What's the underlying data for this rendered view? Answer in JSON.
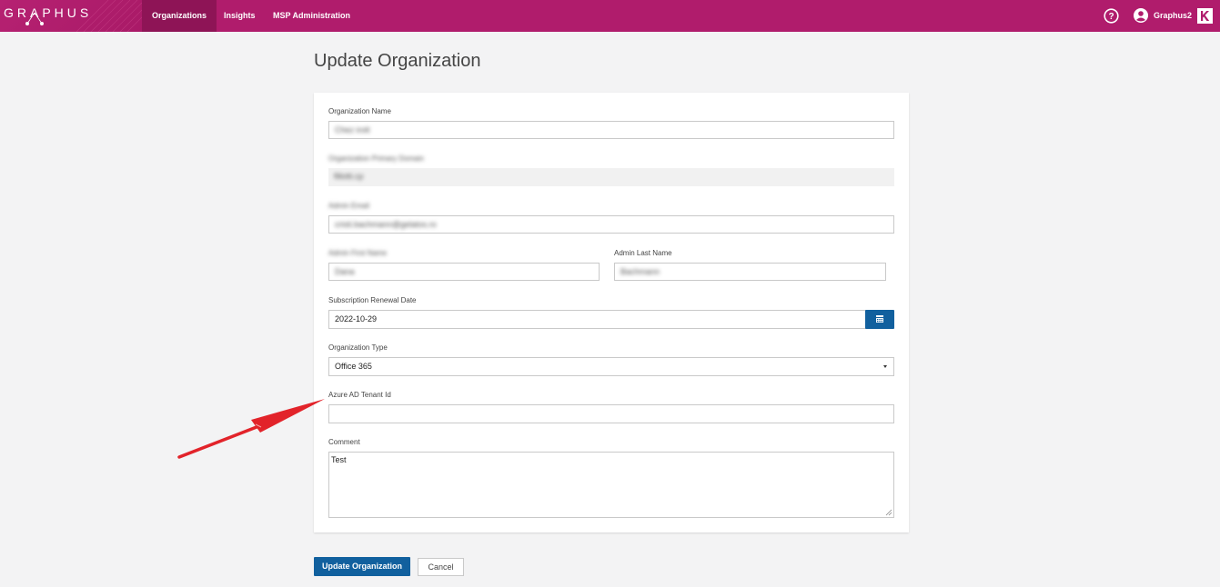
{
  "header": {
    "logo_text": "GRAPHUS",
    "nav": [
      {
        "label": "Organizations",
        "active": true
      },
      {
        "label": "Insights",
        "active": false
      },
      {
        "label": "MSP Administration",
        "active": false
      }
    ],
    "user_name": "Graphus2",
    "brand_color": "#b01c6c"
  },
  "page": {
    "title": "Update Organization"
  },
  "form": {
    "org_name_label": "Organization Name",
    "org_name_value": "Chez irott",
    "primary_domain_label": "Organization Primary Domain",
    "primary_domain_value": "fillotti.cp",
    "admin_email_label": "Admin Email",
    "admin_email_value": "cristi.bachmann@gelatos.ro",
    "admin_first_label": "Admin First Name",
    "admin_first_value": "Dana",
    "admin_last_label": "Admin Last Name",
    "admin_last_value": "Bachmann",
    "renewal_label": "Subscription Renewal Date",
    "renewal_value": "2022-10-29",
    "org_type_label": "Organization Type",
    "org_type_value": "Office 365",
    "tenant_label": "Azure AD Tenant Id",
    "tenant_value": "",
    "comment_label": "Comment",
    "comment_value": "Test"
  },
  "actions": {
    "update_label": "Update Organization",
    "cancel_label": "Cancel"
  },
  "icons": {
    "help": "help-circle-icon",
    "user": "user-circle-icon",
    "brand": "kaseya-k-icon",
    "calendar": "calendar-icon",
    "dropdown": "caret-down-icon"
  },
  "annotation_color": "#e2232a"
}
